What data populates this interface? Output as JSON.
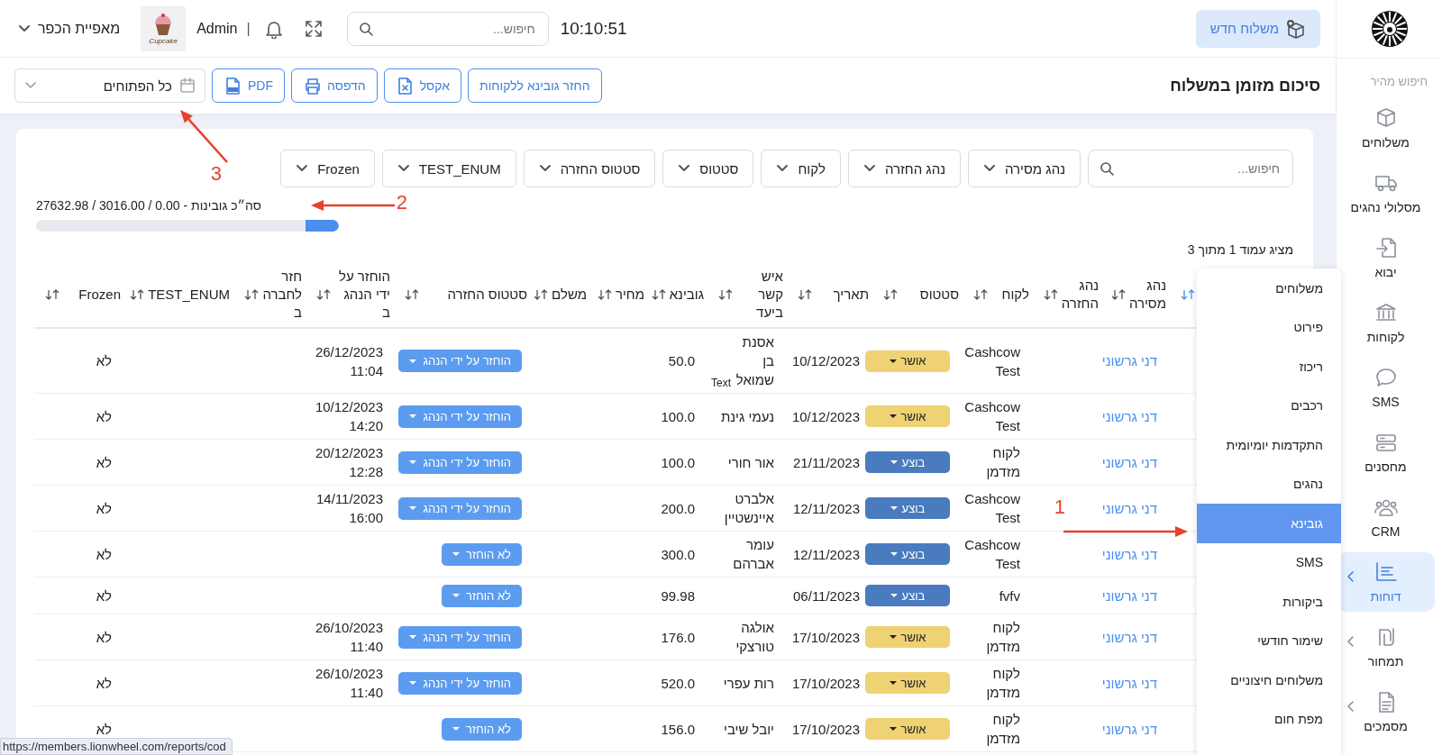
{
  "topbar": {
    "account": "מאפיית הכפר",
    "logo_text": "Cupcake",
    "user": "Admin",
    "separator": "|",
    "search": {
      "placeholder": "חיפוש..."
    },
    "clock": "10:10:51",
    "new_button": "משלוח חדש"
  },
  "subheader": {
    "title": "סיכום מזומן במשלוח",
    "actions": [
      {
        "label": "החזר גובינא ללקוחות"
      },
      {
        "label": "אקסל"
      },
      {
        "label": "הדפסה"
      },
      {
        "label": "PDF"
      }
    ],
    "date_range": "כל הפתוחים"
  },
  "filters": {
    "search": {
      "placeholder": "חיפוש..."
    },
    "dropdowns": [
      "נהג מסירה",
      "נהג החזרה",
      "לקוח",
      "סטטוס",
      "סטטוס החזרה",
      "TEST_ENUM",
      "Frozen"
    ]
  },
  "summary": {
    "text": "סה״כ גובינות - 0.00 / 3016.00 / 27632.98",
    "level": 0.11
  },
  "pager": "מציג עמוד 1 מתוך 3",
  "table": {
    "columns": [
      {
        "sort_active": true
      },
      {
        "label": "נהג מסירה",
        "sort_active": false
      },
      {
        "label": "נהג החזרה",
        "sort_active": false
      },
      {
        "label": "לקוח",
        "sort_active": false
      },
      {
        "label": "סטטוס",
        "sort_active": false
      },
      {
        "label": "תאריך",
        "sort_active": false
      },
      {
        "label": "איש קשר ביעד",
        "sort_active": false
      },
      {
        "label": "גובינא",
        "sort_active": false
      },
      {
        "label": "מחיר",
        "sort_active": false
      },
      {
        "label": "משלם",
        "sort_active": false
      },
      {
        "label": "סטטוס החזרה",
        "sort_active": false
      },
      {
        "label": "הוחזר על ידי הנהג ב",
        "sort_active": false
      },
      {
        "label": "חזר לחברה ב",
        "sort_active": false
      },
      {
        "label": "TEST_ENUM",
        "sort_active": false
      },
      {
        "label": "Frozen",
        "sort_active": false
      }
    ],
    "rows": [
      {
        "delivery_driver": "דני גרשוני",
        "customer": "Cashcow Test",
        "status": {
          "label": "אושר",
          "kind": "approved"
        },
        "date": "10/12/2023",
        "contact": "אסנת בן שמואל",
        "contact_note": "Text",
        "amount": "50.0",
        "return_status": "הוחזר על ידי הנהג",
        "returned_at": "26/12/2023 11:04",
        "frozen": "לא"
      },
      {
        "delivery_driver": "דני גרשוני",
        "customer": "Cashcow Test",
        "status": {
          "label": "אושר",
          "kind": "approved"
        },
        "date": "10/12/2023",
        "contact": "נעמי גינת",
        "amount": "100.0",
        "return_status": "הוחזר על ידי הנהג",
        "returned_at": "10/12/2023 14:20",
        "frozen": "לא"
      },
      {
        "delivery_driver": "דני גרשוני",
        "customer": "לקוח מזדמן",
        "status": {
          "label": "בוצע",
          "kind": "done"
        },
        "date": "21/11/2023",
        "contact": "אור חורי",
        "amount": "100.0",
        "return_status": "הוחזר על ידי הנהג",
        "returned_at": "20/12/2023 12:28",
        "frozen": "לא"
      },
      {
        "delivery_driver": "דני גרשוני",
        "customer": "Cashcow Test",
        "status": {
          "label": "בוצע",
          "kind": "done"
        },
        "date": "12/11/2023",
        "contact": "אלברט איינשטיין",
        "amount": "200.0",
        "return_status": "הוחזר על ידי הנהג",
        "returned_at": "14/11/2023 16:00",
        "frozen": "לא"
      },
      {
        "delivery_driver": "דני גרשוני",
        "customer": "Cashcow Test",
        "status": {
          "label": "בוצע",
          "kind": "done"
        },
        "date": "12/11/2023",
        "contact": "עומר אברהם",
        "amount": "300.0",
        "return_status": "לא הוחזר",
        "frozen": "לא"
      },
      {
        "delivery_driver": "דני גרשוני",
        "customer": "fvfv",
        "status": {
          "label": "בוצע",
          "kind": "done"
        },
        "date": "06/11/2023",
        "amount": "99.98",
        "return_status": "לא הוחזר",
        "frozen": "לא"
      },
      {
        "delivery_driver": "דני גרשוני",
        "customer": "לקוח מזדמן",
        "status": {
          "label": "אושר",
          "kind": "approved"
        },
        "date": "17/10/2023",
        "contact": "אולגה טורצקי",
        "amount": "176.0",
        "return_status": "הוחזר על ידי הנהג",
        "returned_at": "26/10/2023 11:40",
        "frozen": "לא"
      },
      {
        "delivery_driver": "דני גרשוני",
        "customer": "לקוח מזדמן",
        "status": {
          "label": "אושר",
          "kind": "approved"
        },
        "date": "17/10/2023",
        "contact": "רות עפרי",
        "amount": "520.0",
        "return_status": "הוחזר על ידי הנהג",
        "returned_at": "26/10/2023 11:40",
        "frozen": "לא"
      },
      {
        "delivery_driver": "דני גרשוני",
        "customer": "לקוח מזדמן",
        "status": {
          "label": "אושר",
          "kind": "approved"
        },
        "date": "17/10/2023",
        "contact": "יובל שיבי",
        "amount": "156.0",
        "return_status": "לא הוחזר",
        "frozen": "לא"
      }
    ]
  },
  "sidebar": {
    "quick_search": "חיפוש מהיר",
    "items": [
      {
        "label": "משלוחים",
        "expandable": false,
        "selected": false
      },
      {
        "label": "מסלולי נהגים",
        "expandable": false,
        "selected": false
      },
      {
        "label": "יבוא",
        "expandable": false,
        "selected": false
      },
      {
        "label": "לקוחות",
        "expandable": false,
        "selected": false
      },
      {
        "label": "SMS",
        "expandable": false,
        "selected": false
      },
      {
        "label": "מחסנים",
        "expandable": false,
        "selected": false
      },
      {
        "label": "CRM",
        "expandable": false,
        "selected": false
      },
      {
        "label": "דוחות",
        "expandable": true,
        "selected": true
      },
      {
        "label": "תמחור",
        "expandable": true,
        "selected": false
      },
      {
        "label": "מסמכים",
        "expandable": true,
        "selected": false
      }
    ]
  },
  "reports_menu": {
    "items": [
      {
        "label": "משלוחים",
        "selected": false
      },
      {
        "label": "פירוט",
        "selected": false
      },
      {
        "label": "ריכוז",
        "selected": false
      },
      {
        "label": "רכבים",
        "selected": false
      },
      {
        "label": "התקדמות יומיומית",
        "selected": false
      },
      {
        "label": "נהגים",
        "selected": false
      },
      {
        "label": "גובינא",
        "selected": true
      },
      {
        "label": "SMS",
        "selected": false
      },
      {
        "label": "ביקורות",
        "selected": false
      },
      {
        "label": "שימור חודשי",
        "selected": false
      },
      {
        "label": "משלוחים חיצוניים",
        "selected": false
      },
      {
        "label": "מפת חום",
        "selected": false
      }
    ]
  },
  "annotations": [
    {
      "number": "1"
    },
    {
      "number": "2"
    },
    {
      "number": "3"
    }
  ],
  "status_url": "https://members.lionwheel.com/reports/cod"
}
